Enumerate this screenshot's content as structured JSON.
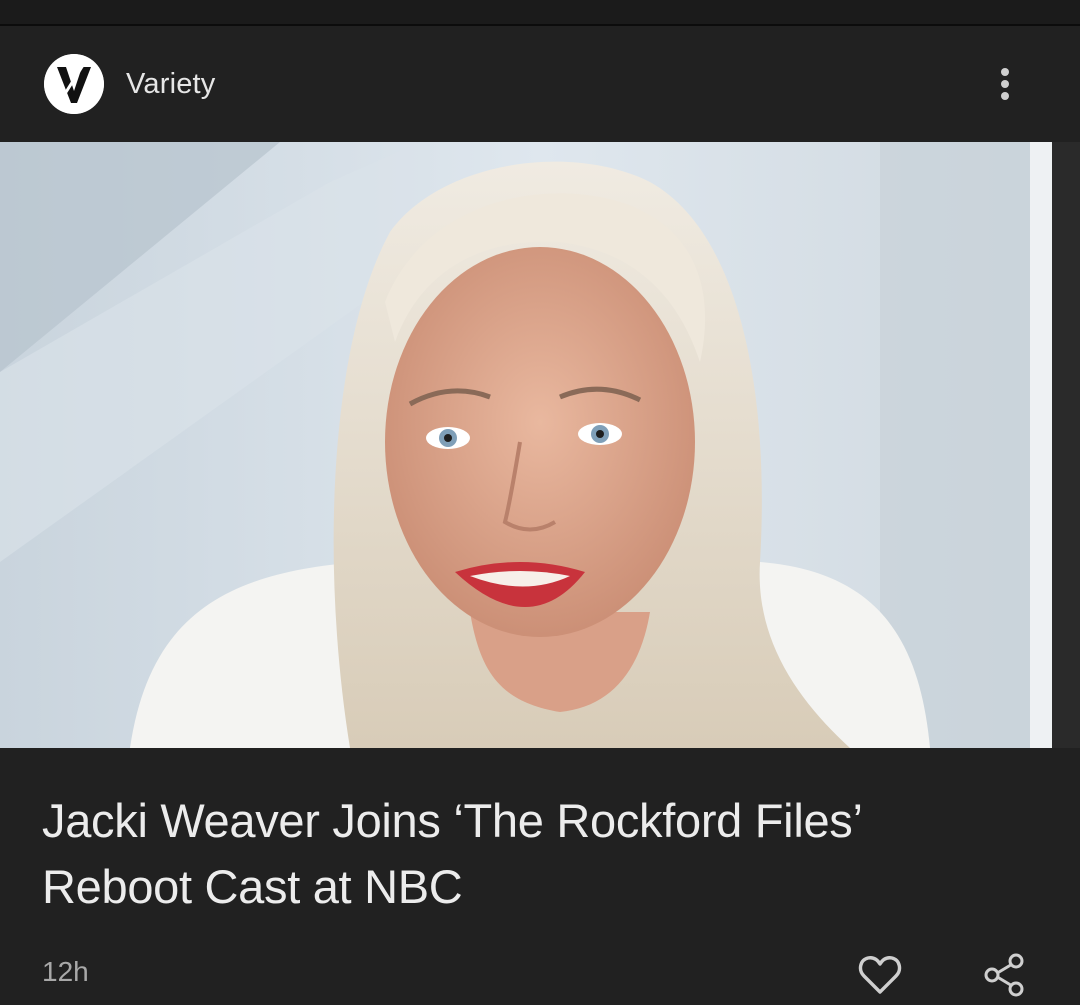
{
  "card": {
    "publisher": {
      "name": "Variety",
      "logo_icon": "variety-logo-icon"
    },
    "menu_icon": "more-vertical-icon",
    "image": {
      "subject": "portrait-photo"
    },
    "headline": "Jacki Weaver Joins ‘The Rockford Files’\nReboot Cast at NBC",
    "timestamp": "12h",
    "actions": {
      "like_icon": "heart-outline-icon",
      "share_icon": "share-icon"
    }
  },
  "colors": {
    "card_background": "#212121",
    "page_background": "#1a1a1a",
    "headline_text": "#ececec",
    "secondary_text": "#a8a8a8"
  }
}
